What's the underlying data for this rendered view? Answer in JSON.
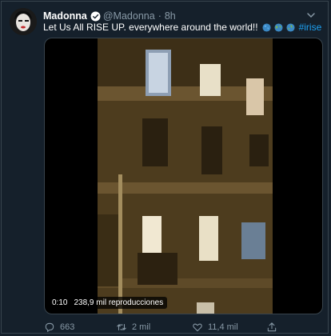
{
  "tweet": {
    "author_name": "Madonna",
    "handle": "@Madonna",
    "separator": "·",
    "time": "8h",
    "text_main": "Let Us All RISE UP. everywhere around the world!!",
    "hashtag": "#irise"
  },
  "video": {
    "duration": "0:10",
    "views": "238,9 mil reproducciones"
  },
  "actions": {
    "replies": "663",
    "retweets": "2 mil",
    "likes": "11,4 mil"
  },
  "colors": {
    "background": "#15202b",
    "secondary_text": "#8899a6",
    "accent": "#1da1f2"
  }
}
